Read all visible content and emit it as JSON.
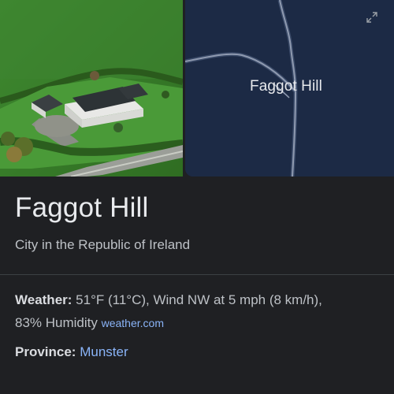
{
  "place": {
    "map_label": "Faggot Hill",
    "title": "Faggot Hill",
    "subtitle": "City in the Republic of Ireland"
  },
  "weather": {
    "label": "Weather:",
    "value_line1": " 51°F (11°C), Wind NW at 5 mph (8 km/h),",
    "value_line2": "83% Humidity ",
    "source": "weather.com"
  },
  "province": {
    "label": "Province:",
    "value": "Munster"
  },
  "icons": {
    "expand": "expand-icon"
  },
  "colors": {
    "background": "#1f2023",
    "map_background": "#1c2a45",
    "link": "#8ab4f8",
    "primary_text": "#e8eaed",
    "secondary_text": "#bdc1c6"
  }
}
